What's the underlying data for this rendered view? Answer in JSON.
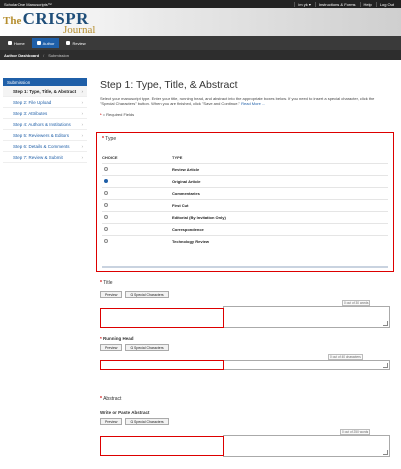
{
  "topbar": {
    "brand": "ScholarOne Manuscripts™",
    "links": [
      "im yk ▾",
      "Instructions & Forms",
      "Help",
      "Log Out"
    ]
  },
  "logo": {
    "the": "The",
    "main": "CRISPR",
    "journal": "Journal"
  },
  "nav": {
    "tabs": [
      "Home",
      "Author",
      "Review"
    ]
  },
  "subnav": {
    "items": [
      "Author Dashboard",
      "/",
      "Submission"
    ]
  },
  "sidebar": {
    "heading": "Submission",
    "steps": [
      "Step 1: Type, Title, & Abstract",
      "Step 2: File Upload",
      "Step 3: Attributes",
      "Step 4: Authors & Institutions",
      "Step 5: Reviewers & Editors",
      "Step 6: Details & Comments",
      "Step 7: Review & Submit"
    ]
  },
  "main": {
    "title": "Step 1: Type, Title, & Abstract",
    "intro": "Select your manuscript type. Enter your title, running head, and abstract into the appropriate boxes below. If you need to insert a special character, click the \"Special Characters\" button. When you are finished, click \"Save and Continue.\"",
    "read_more": "Read More ...",
    "required_note": "= Required Fields",
    "required_star": "*"
  },
  "type_section": {
    "label": "Type",
    "col_choice": "CHOICE",
    "col_type": "TYPE",
    "options": [
      {
        "label": "Review Article",
        "selected": false
      },
      {
        "label": "Original Article",
        "selected": true
      },
      {
        "label": "Commentaries",
        "selected": false
      },
      {
        "label": "First Cut",
        "selected": false
      },
      {
        "label": "Editorial (By Invitation Only)",
        "selected": false
      },
      {
        "label": "Correspondence",
        "selected": false
      },
      {
        "label": "Technology Review",
        "selected": false
      }
    ]
  },
  "title_section": {
    "label": "Title",
    "preview": "Preview",
    "special": "Ω Special Characters",
    "counter": "0 out of 30 words"
  },
  "running_head": {
    "label": "Running Head",
    "preview": "Preview",
    "special": "Ω Special Characters",
    "counter": "0 out of 40 characters"
  },
  "abstract_section": {
    "label": "Abstract",
    "sublabel": "Write or Paste Abstract",
    "preview": "Preview",
    "special": "Ω Special Characters",
    "counter": "0 out of 250 words"
  },
  "colors": {
    "accent": "#1f5fa8",
    "highlight": "#dd0000",
    "nav": "#3a3a3a"
  }
}
